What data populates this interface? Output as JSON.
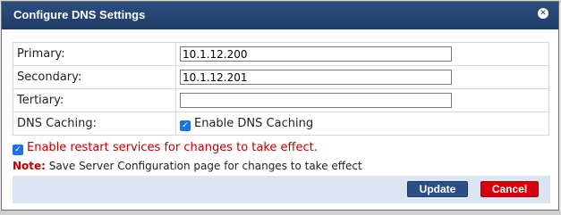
{
  "dialog": {
    "title": "Configure DNS Settings",
    "close_icon": "close-icon"
  },
  "fields": {
    "primary_label": "Primary:",
    "primary_value": "10.1.12.200",
    "secondary_label": "Secondary:",
    "secondary_value": "10.1.12.201",
    "tertiary_label": "Tertiary:",
    "tertiary_value": "",
    "dns_caching_label": "DNS Caching:",
    "dns_caching_checkbox_label": "Enable DNS Caching",
    "dns_caching_checked": true
  },
  "restart": {
    "label": "Enable restart services for changes to take effect.",
    "checked": true
  },
  "note": {
    "label": "Note:",
    "text": "Save Server Configuration page for changes to take effect"
  },
  "buttons": {
    "update_label": "Update",
    "cancel_label": "Cancel"
  },
  "colors": {
    "title_bar": "#1f3c67",
    "warning_text": "#c00000",
    "update_button": "#2d4f86",
    "cancel_button": "#d8000c",
    "button_bar": "#dbe5f2"
  }
}
